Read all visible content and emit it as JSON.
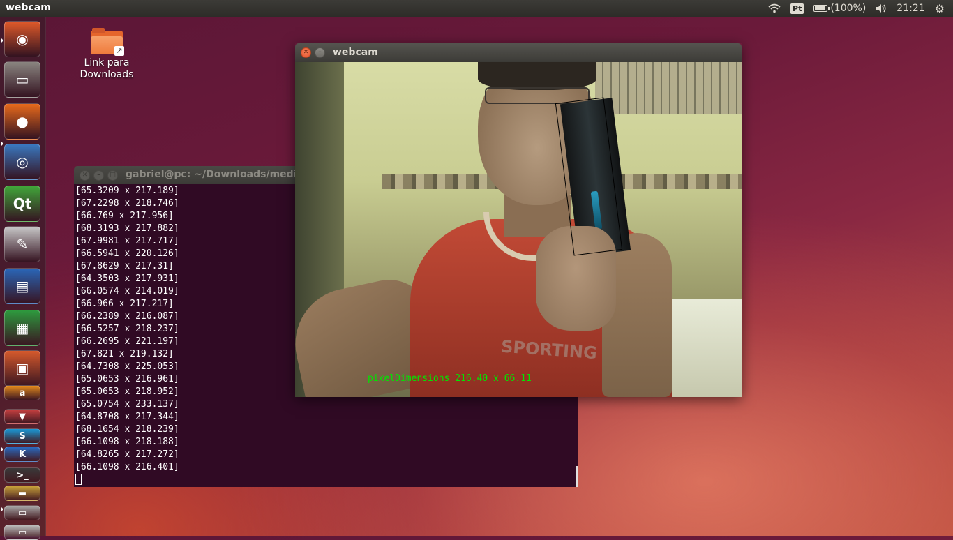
{
  "top_panel": {
    "app_title": "webcam",
    "keyboard_layout": "Pt",
    "battery_text": "(100%)",
    "battery_level": 1.0,
    "clock": "21:21",
    "icons": [
      "wifi-icon",
      "battery-icon",
      "volume-icon",
      "settings-gear-icon"
    ]
  },
  "launcher": {
    "items": [
      {
        "name": "ubuntu-dash",
        "glyph": "◉",
        "color": "#e05a2a"
      },
      {
        "name": "files",
        "glyph": "▭",
        "color": "#8a8580"
      },
      {
        "name": "firefox",
        "glyph": "●",
        "color": "#e86a1c"
      },
      {
        "name": "chromium",
        "glyph": "◎",
        "color": "#3a78c0"
      },
      {
        "name": "qt-creator",
        "glyph": "Qt",
        "color": "#41a63a"
      },
      {
        "name": "text-editor",
        "glyph": "✎",
        "color": "#c8c8c8"
      },
      {
        "name": "libreoffice-writer",
        "glyph": "▤",
        "color": "#2a66b8"
      },
      {
        "name": "libreoffice-calc",
        "glyph": "▦",
        "color": "#2e9a3e"
      },
      {
        "name": "libreoffice-impress",
        "glyph": "▣",
        "color": "#d65a2c"
      },
      {
        "name": "amazon",
        "glyph": "a",
        "color": "#e28a1c"
      },
      {
        "name": "software-updater",
        "glyph": "▼",
        "color": "#c84040"
      },
      {
        "name": "skype",
        "glyph": "S",
        "color": "#1a9ad8"
      },
      {
        "name": "kde-app",
        "glyph": "K",
        "color": "#2a6ac0"
      },
      {
        "name": "terminal",
        "glyph": ">_",
        "color": "#3a3a3a"
      },
      {
        "name": "scanner",
        "glyph": "▬",
        "color": "#c9a23a"
      },
      {
        "name": "disk",
        "glyph": "▭",
        "color": "#a8a8a8"
      },
      {
        "name": "trash",
        "glyph": "▭",
        "color": "#bcbcbc"
      }
    ]
  },
  "desktop": {
    "icon_label": "Link para\nDownloads",
    "icon_arrow": "↗"
  },
  "terminal": {
    "title": "gabriel@pc: ~/Downloads/medir_d",
    "lines": [
      "[65.3209 x 217.189]",
      "[67.2298 x 218.746]",
      "[66.769 x 217.956]",
      "[68.3193 x 217.882]",
      "[67.9981 x 217.717]",
      "[66.5941 x 220.126]",
      "[67.8629 x 217.31]",
      "[64.3503 x 217.931]",
      "[66.0574 x 214.019]",
      "[66.966 x 217.217]",
      "[66.2389 x 216.087]",
      "[66.5257 x 218.237]",
      "[66.2695 x 221.197]",
      "[67.821 x 219.132]",
      "[64.7308 x 225.053]",
      "[65.0653 x 216.961]",
      "[65.0653 x 218.952]",
      "[65.0754 x 233.137]",
      "[64.8708 x 217.344]",
      "[68.1654 x 218.239]",
      "[66.1098 x 218.188]",
      "[64.8265 x 217.272]",
      "[66.1098 x 216.401]"
    ]
  },
  "webcam": {
    "title": "webcam",
    "overlay_text": "pixelDimensions 216.40 x 66.11",
    "shirt_text": "SPORTING CO",
    "overlay_color": "#00e600"
  },
  "window_buttons": {
    "close": "✕",
    "minimize": "–",
    "maximize": "□"
  }
}
